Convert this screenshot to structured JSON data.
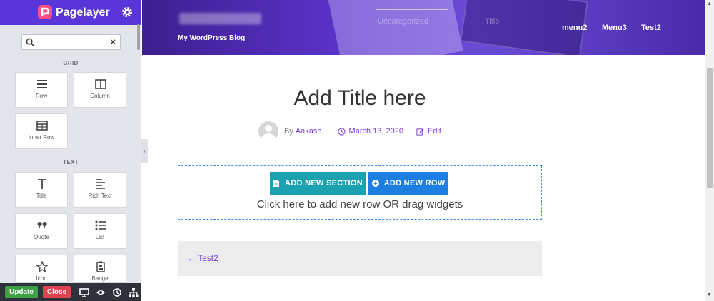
{
  "sidebar": {
    "brand": "Pagelayer",
    "search": {
      "value": "",
      "placeholder": ""
    },
    "sections": [
      {
        "title": "GRID",
        "widgets": [
          {
            "label": "Row",
            "icon": "row-icon"
          },
          {
            "label": "Column",
            "icon": "column-icon"
          },
          {
            "label": "Inner Row",
            "icon": "inner-row-icon"
          }
        ]
      },
      {
        "title": "TEXT",
        "widgets": [
          {
            "label": "Title",
            "icon": "title-icon"
          },
          {
            "label": "Rich Text",
            "icon": "rich-text-icon"
          },
          {
            "label": "Quote",
            "icon": "quote-icon"
          },
          {
            "label": "List",
            "icon": "list-icon"
          },
          {
            "label": "Icon",
            "icon": "star-icon"
          },
          {
            "label": "Badge",
            "icon": "badge-icon"
          }
        ]
      }
    ],
    "footer": {
      "update_label": "Update",
      "close_label": "Close"
    }
  },
  "header": {
    "tagline": "My WordPress Blog",
    "faded_menu": [
      "Uncategorized",
      "Title"
    ],
    "menu": [
      "menu2",
      "Menu3",
      "Test2"
    ]
  },
  "post": {
    "title": "Add Title here",
    "by_prefix": "By",
    "author": "Aakash",
    "date": "March 13, 2020",
    "edit_label": "Edit"
  },
  "builder": {
    "add_section_label": "ADD NEW SECTION",
    "add_row_label": "ADD NEW ROW",
    "hint": "Click here to add new row OR drag widgets"
  },
  "post_nav": {
    "prev_label": "← Test2"
  },
  "colors": {
    "accent": "#5a35d8",
    "update": "#3ea045",
    "close": "#e0434e",
    "section_btn": "#1ba1b0",
    "row_btn": "#1b7ee0",
    "link": "#7a3fd9"
  }
}
